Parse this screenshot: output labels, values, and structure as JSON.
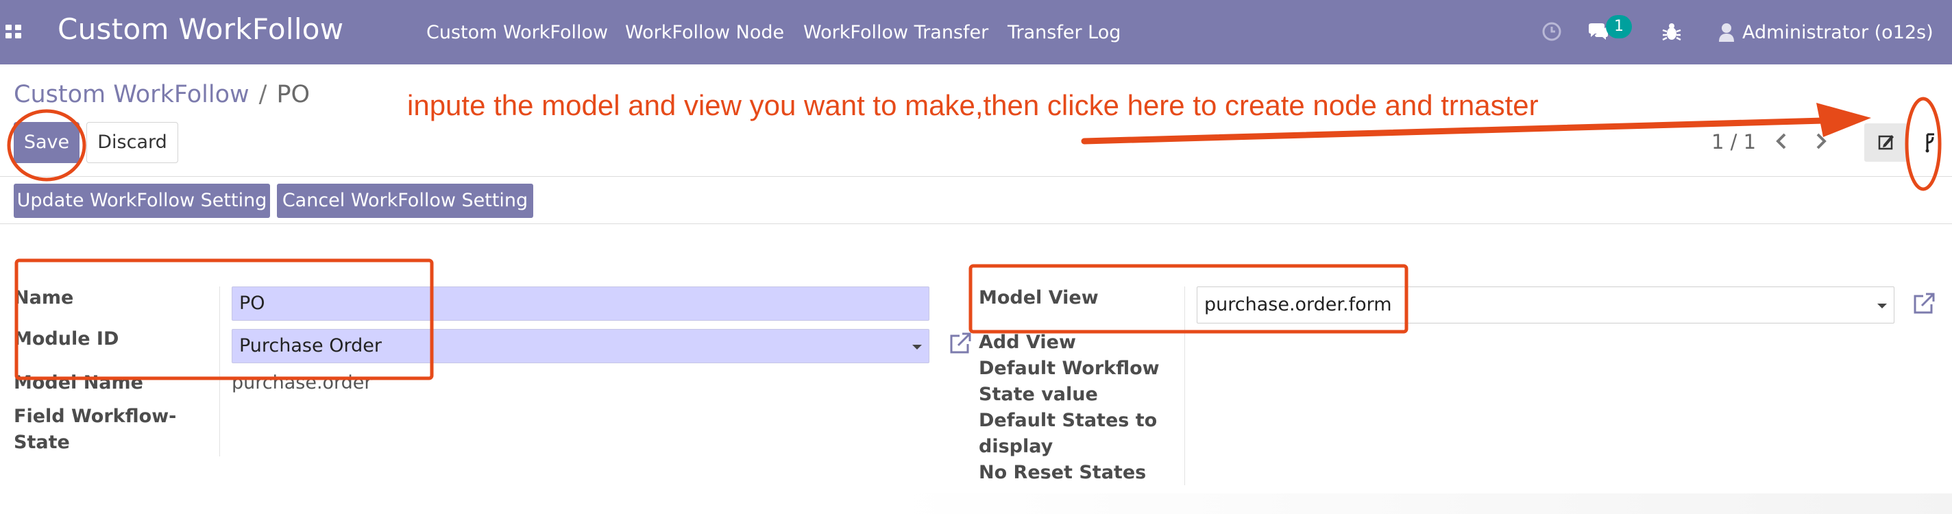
{
  "navbar": {
    "brand": "Custom WorkFollow",
    "menu": [
      "Custom WorkFollow",
      "WorkFollow Node",
      "WorkFollow Transfer",
      "Transfer Log"
    ],
    "messages_badge": "1",
    "user": "Administrator (o12s)",
    "icons": [
      "apps-icon",
      "clock-icon",
      "chat-icon",
      "bug-icon",
      "user-icon"
    ]
  },
  "breadcrumb": {
    "parent": "Custom WorkFollow",
    "separator": "/",
    "current": "PO"
  },
  "buttons": {
    "save": "Save",
    "discard": "Discard",
    "update_setting": "Update WorkFollow Setting",
    "cancel_setting": "Cancel WorkFollow Setting"
  },
  "annotation": {
    "text": "inpute the model and view you want to make,then clicke here to create node and trnaster",
    "color": "#e64a19"
  },
  "pager": {
    "value": "1 / 1"
  },
  "form": {
    "left": {
      "name_label": "Name",
      "name_value": "PO",
      "module_label": "Module ID",
      "module_value": "Purchase Order",
      "model_name_label": "Model Name",
      "model_name_value": "purchase.order",
      "field_state_label_1": "Field Workflow-",
      "field_state_label_2": "State"
    },
    "right": {
      "model_view_label": "Model View",
      "model_view_value": "purchase.order.form",
      "add_view_label": "Add View",
      "default_workflow_label": "Default Workflow",
      "state_value_label": "State value",
      "default_states_label_1": "Default States to",
      "default_states_label_2": "display",
      "no_reset_label": "No Reset States"
    }
  },
  "colors": {
    "primary": "#7c7bad",
    "badge": "#00a09d",
    "required_field": "#d2d2ff",
    "annotation": "#e64a19"
  }
}
